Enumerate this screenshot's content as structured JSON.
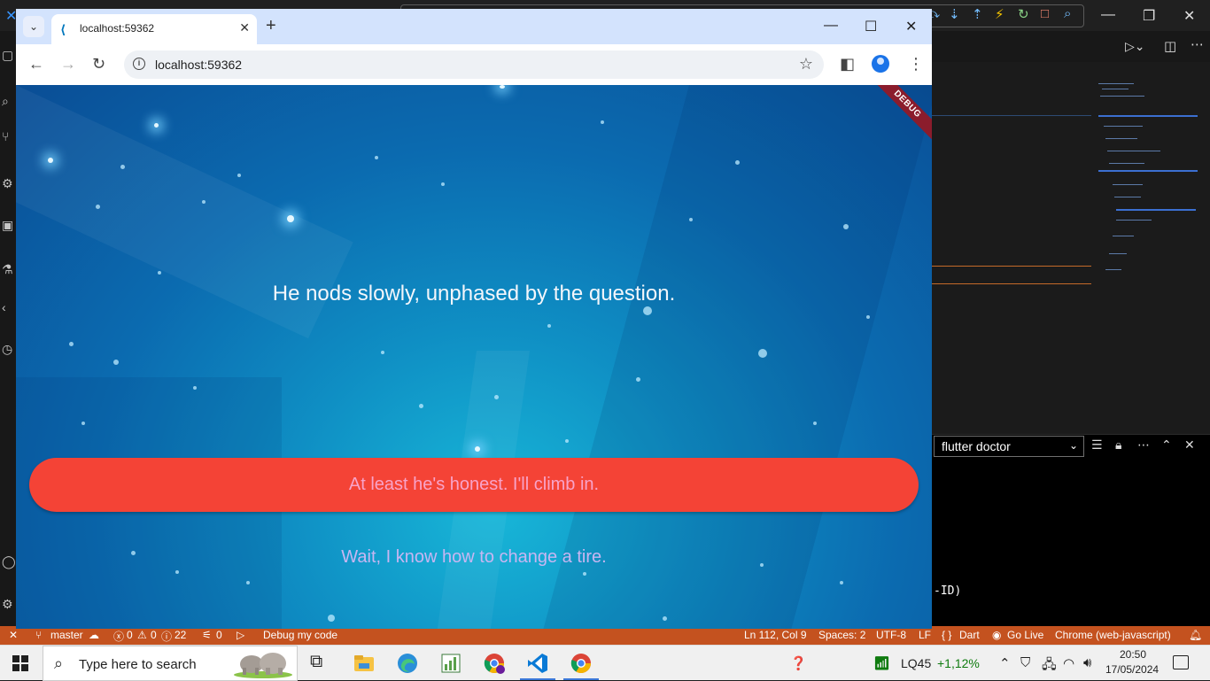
{
  "browser": {
    "tab_title": "localhost:59362",
    "url": "localhost:59362",
    "icons": {
      "tab_search": "chevron-down-icon",
      "favicon": "flutter-icon",
      "close": "close-icon",
      "new_tab": "plus-icon",
      "back": "arrow-left-icon",
      "forward": "arrow-right-icon",
      "reload": "reload-icon",
      "bookmark": "star-icon",
      "side_panel": "side-panel-icon",
      "profile": "profile-icon",
      "menu": "kebab-menu-icon"
    }
  },
  "app": {
    "debug_banner": "DEBUG",
    "narration": "He nods slowly, unphased by the question.",
    "choices": [
      "At least he's honest. I'll climb in.",
      "Wait, I know how to change a tire."
    ],
    "colors": {
      "primary_button": "#f44336",
      "primary_text": "#f8a3c9",
      "secondary_text": "#c7b6f2",
      "narration_text": "#f3f6fb"
    }
  },
  "vscode": {
    "terminal_select": "flutter doctor",
    "terminal_fragment": "-ID)",
    "statusbar": {
      "branch": "master",
      "errors": "0",
      "warnings": "0",
      "infos": "22",
      "ports": "0",
      "debug_config": "Debug my code",
      "cursor": "Ln 112, Col 9",
      "spaces": "Spaces: 2",
      "encoding": "UTF-8",
      "eol": "LF",
      "language": "Dart",
      "go_live": "Go Live",
      "device": "Chrome (web-javascript)",
      "accent": "#c4521f"
    }
  },
  "taskbar": {
    "search_placeholder": "Type here to search",
    "stock_name": "LQ45",
    "stock_change": "+1,12%",
    "time": "20:50",
    "date": "17/05/2024"
  }
}
